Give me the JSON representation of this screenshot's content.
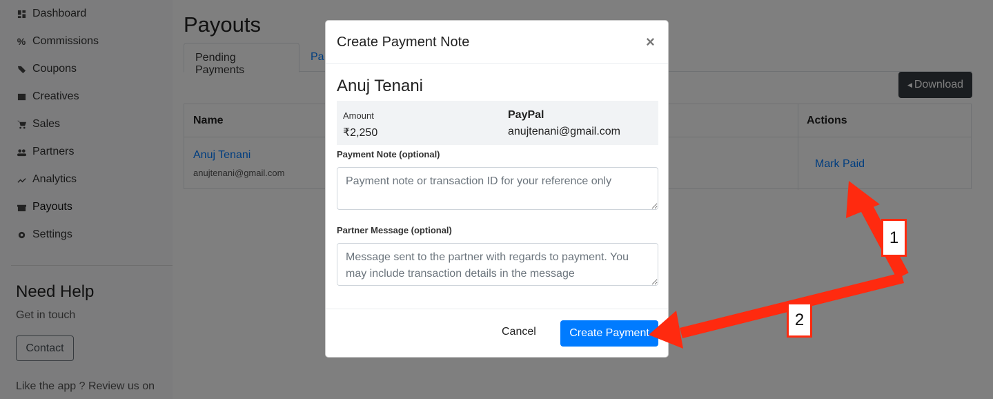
{
  "sidebar": {
    "items": [
      {
        "label": "Dashboard",
        "icon": "dashboard-icon"
      },
      {
        "label": "Commissions",
        "icon": "percent-icon"
      },
      {
        "label": "Coupons",
        "icon": "tags-icon"
      },
      {
        "label": "Creatives",
        "icon": "image-icon"
      },
      {
        "label": "Sales",
        "icon": "cart-icon"
      },
      {
        "label": "Partners",
        "icon": "users-icon"
      },
      {
        "label": "Analytics",
        "icon": "chart-line-icon"
      },
      {
        "label": "Payouts",
        "icon": "gift-icon"
      },
      {
        "label": "Settings",
        "icon": "gear-icon"
      }
    ],
    "help_title": "Need Help",
    "help_subtitle": "Get in touch",
    "contact_label": "Contact",
    "review_text": "Like the app ? Review us on"
  },
  "main": {
    "title": "Payouts",
    "tabs": [
      {
        "label": "Pending Payments"
      },
      {
        "label": "Pa"
      }
    ],
    "download_label": "Download",
    "table": {
      "headers": {
        "name": "Name",
        "actions": "Actions"
      },
      "rows": [
        {
          "name": "Anuj Tenani",
          "email": "anujtenani@gmail.com",
          "action": "Mark Paid"
        }
      ]
    }
  },
  "modal": {
    "title": "Create Payment Note",
    "close_symbol": "×",
    "partner_name": "Anuj Tenani",
    "amount_label": "Amount",
    "amount_value": "₹2,250",
    "method": "PayPal",
    "method_email": "anujtenani@gmail.com",
    "payment_note_label": "Payment Note (optional)",
    "payment_note_placeholder": "Payment note or transaction ID for your reference only",
    "partner_message_label": "Partner Message (optional)",
    "partner_message_placeholder": "Message sent to the partner with regards to payment. You may include transaction details in the message",
    "cancel_label": "Cancel",
    "create_label": "Create Payment"
  },
  "annotations": {
    "step1": "1",
    "step2": "2",
    "color": "#ff2a0f"
  }
}
